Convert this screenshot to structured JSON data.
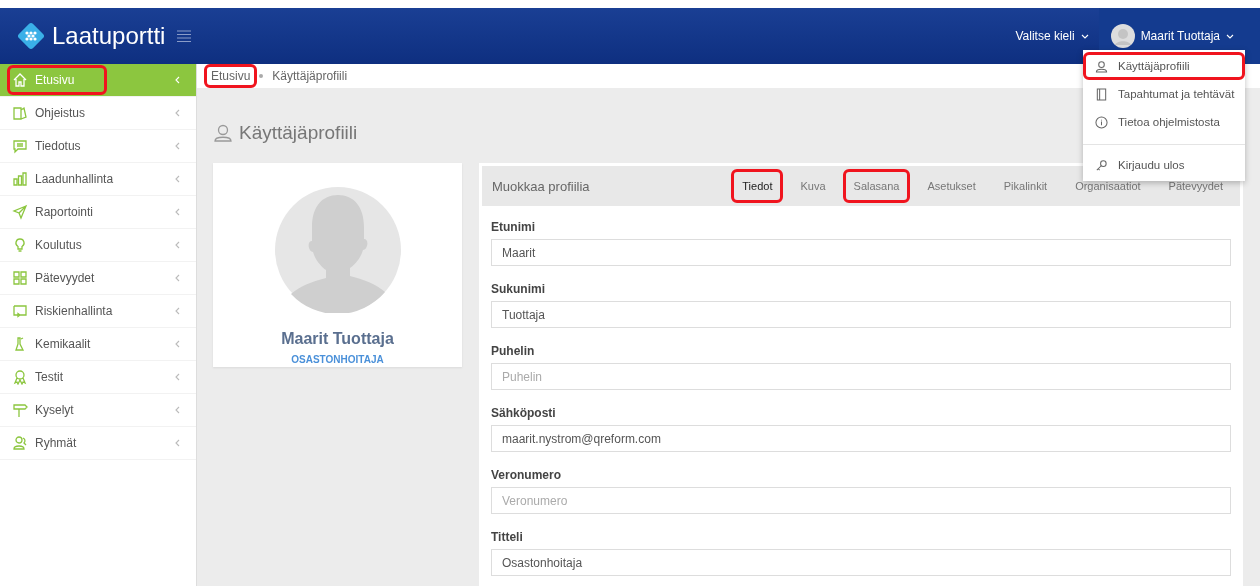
{
  "header": {
    "logo": "Laatuportti",
    "language": "Valitse kieli",
    "user": "Maarit Tuottaja"
  },
  "user_menu": [
    {
      "kind": "profile",
      "label": "Käyttäjäprofiili",
      "highlighted": true
    },
    {
      "kind": "tasks",
      "label": "Tapahtumat ja tehtävät",
      "highlighted": false
    },
    {
      "kind": "info",
      "label": "Tietoa ohjelmistosta",
      "highlighted": false
    },
    {
      "kind": "logout",
      "label": "Kirjaudu ulos",
      "highlighted": false
    }
  ],
  "sidebar": {
    "items": [
      {
        "kind": "home",
        "label": "Etusivu",
        "selected": true,
        "highlighted": true
      },
      {
        "kind": "docs",
        "label": "Ohjeistus",
        "selected": false,
        "highlighted": false
      },
      {
        "kind": "chat",
        "label": "Tiedotus",
        "selected": false,
        "highlighted": false
      },
      {
        "kind": "bars",
        "label": "Laadunhallinta",
        "selected": false,
        "highlighted": false
      },
      {
        "kind": "send",
        "label": "Raportointi",
        "selected": false,
        "highlighted": false
      },
      {
        "kind": "bulb",
        "label": "Koulutus",
        "selected": false,
        "highlighted": false
      },
      {
        "kind": "grid",
        "label": "Pätevyydet",
        "selected": false,
        "highlighted": false
      },
      {
        "kind": "screen",
        "label": "Riskienhallinta",
        "selected": false,
        "highlighted": false
      },
      {
        "kind": "flask",
        "label": "Kemikaalit",
        "selected": false,
        "highlighted": false
      },
      {
        "kind": "badge",
        "label": "Testit",
        "selected": false,
        "highlighted": false
      },
      {
        "kind": "sign",
        "label": "Kyselyt",
        "selected": false,
        "highlighted": false
      },
      {
        "kind": "users",
        "label": "Ryhmät",
        "selected": false,
        "highlighted": false
      }
    ]
  },
  "breadcrumb": [
    {
      "label": "Etusivu",
      "highlighted": true
    },
    {
      "label": "Käyttäjäprofiili",
      "highlighted": false
    }
  ],
  "page_title": "Käyttäjäprofiili",
  "profile_card": {
    "name": "Maarit Tuottaja",
    "role": "OSASTONHOITAJA"
  },
  "edit_panel": {
    "title": "Muokkaa profiilia",
    "tabs": [
      {
        "label": "Tiedot",
        "selected": true,
        "highlighted": true
      },
      {
        "label": "Kuva",
        "selected": false,
        "highlighted": false
      },
      {
        "label": "Salasana",
        "selected": false,
        "highlighted": true
      },
      {
        "label": "Asetukset",
        "selected": false,
        "highlighted": false
      },
      {
        "label": "Pikalinkit",
        "selected": false,
        "highlighted": false
      },
      {
        "label": "Organisaatiot",
        "selected": false,
        "highlighted": false
      },
      {
        "label": "Pätevyydet",
        "selected": false,
        "highlighted": false
      }
    ],
    "fields": [
      {
        "label": "Etunimi",
        "value": "Maarit"
      },
      {
        "label": "Sukunimi",
        "value": "Tuottaja"
      },
      {
        "label": "Puhelin",
        "placeholder": "Puhelin"
      },
      {
        "label": "Sähköposti",
        "value": "maarit.nystrom@qreform.com"
      },
      {
        "label": "Veronumero",
        "placeholder": "Veronumero"
      },
      {
        "label": "Titteli",
        "value": "Osastonhoitaja"
      }
    ]
  }
}
